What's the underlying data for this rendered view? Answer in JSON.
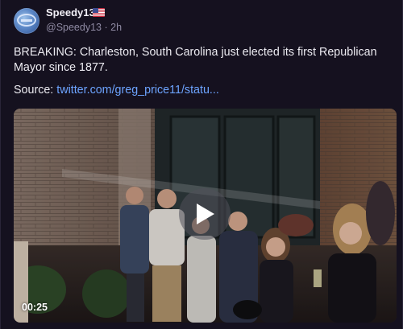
{
  "post": {
    "author": {
      "display_name": "Speedy13",
      "handle": "@Speedy13",
      "separator": "·",
      "time_ago": "2h",
      "flag_icon": "us-flag-icon",
      "avatar_icon": "avatar-icon"
    },
    "text": "BREAKING: Charleston, South Carolina just elected its first Republican Mayor since 1877.",
    "source_label": "Source:",
    "source_link": "twitter.com/greg_price11/statu..."
  },
  "video": {
    "duration": "00:25",
    "play_icon": "play-icon"
  },
  "colors": {
    "background": "#15111f",
    "text": "#ecebf1",
    "muted": "#8f8aa3",
    "link": "#6da4ff"
  }
}
